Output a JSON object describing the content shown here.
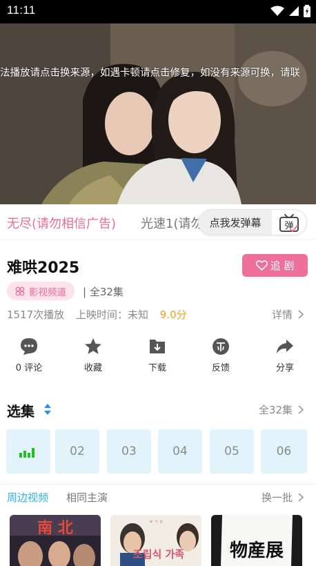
{
  "status_bar": {
    "time": "11:11"
  },
  "video": {
    "ticker": "法播放请点击换来源，如遇卡顿请点击修复，如没有来源可换，请联"
  },
  "sources": {
    "active": "无尽(请勿相信广告)",
    "other": "光速1(请勿"
  },
  "danmu": {
    "label": "点我发弹幕",
    "icon_text": "弹"
  },
  "show": {
    "title": "难哄2025",
    "follow_label": "追 剧",
    "channel": "影视频道",
    "episodes_total": "| 全32集",
    "plays": "1517次播放",
    "release": "上映时间：未知",
    "score": "9.0分",
    "detail_label": "详情"
  },
  "actions": [
    {
      "label": "0 评论",
      "icon": "comment-icon"
    },
    {
      "label": "收藏",
      "icon": "star-icon"
    },
    {
      "label": "下载",
      "icon": "download-icon"
    },
    {
      "label": "反馈",
      "icon": "feedback-icon"
    },
    {
      "label": "分享",
      "icon": "share-icon"
    }
  ],
  "episodes": {
    "title": "选集",
    "all_label": "全32集",
    "items": [
      "playing",
      "02",
      "03",
      "04",
      "05",
      "06"
    ]
  },
  "related": {
    "tab_active": "周边视频",
    "tab_other": "相同主演",
    "refresh_label": "换一批",
    "thumb_texts": [
      "",
      "조립식 가족",
      "物産展"
    ]
  },
  "colors": {
    "accent_pink": "#ef6f9b",
    "accent_blue": "#2fb3e6",
    "score": "#f0a020",
    "episode_bg": "#e3f3fc"
  }
}
